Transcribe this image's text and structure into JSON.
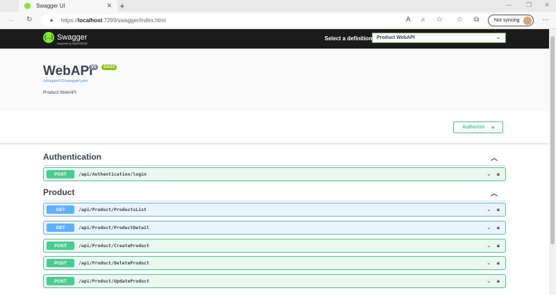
{
  "browser": {
    "tab_title": "Swagger UI",
    "url_prefix": "https://",
    "url_host": "localhost",
    "url_rest": ":7299/swagger/index.html",
    "sync_label": "Not syncing"
  },
  "header": {
    "logo_text": "Swagger",
    "logo_sub": "Supported by SMARTBEAR",
    "definition_label": "Select a definition",
    "definition_value": "Product WebAPI"
  },
  "info": {
    "title": "WebAPI",
    "version_badge": "V1",
    "oas_badge": "OAS3",
    "spec_link": "/swagger/V1/swagger.json",
    "description": "Product WebAPI"
  },
  "authorize_label": "Authorize",
  "sections": [
    {
      "name": "Authentication",
      "ops": [
        {
          "method": "POST",
          "path": "/api/Authentication/login"
        }
      ]
    },
    {
      "name": "Product",
      "ops": [
        {
          "method": "GET",
          "path": "/api/Product/ProductsList"
        },
        {
          "method": "GET",
          "path": "/api/Product/ProductDetail"
        },
        {
          "method": "POST",
          "path": "/api/Product/CreateProduct"
        },
        {
          "method": "POST",
          "path": "/api/Product/DeleteProduct"
        },
        {
          "method": "POST",
          "path": "/api/Product/UpdateProduct"
        }
      ]
    }
  ]
}
